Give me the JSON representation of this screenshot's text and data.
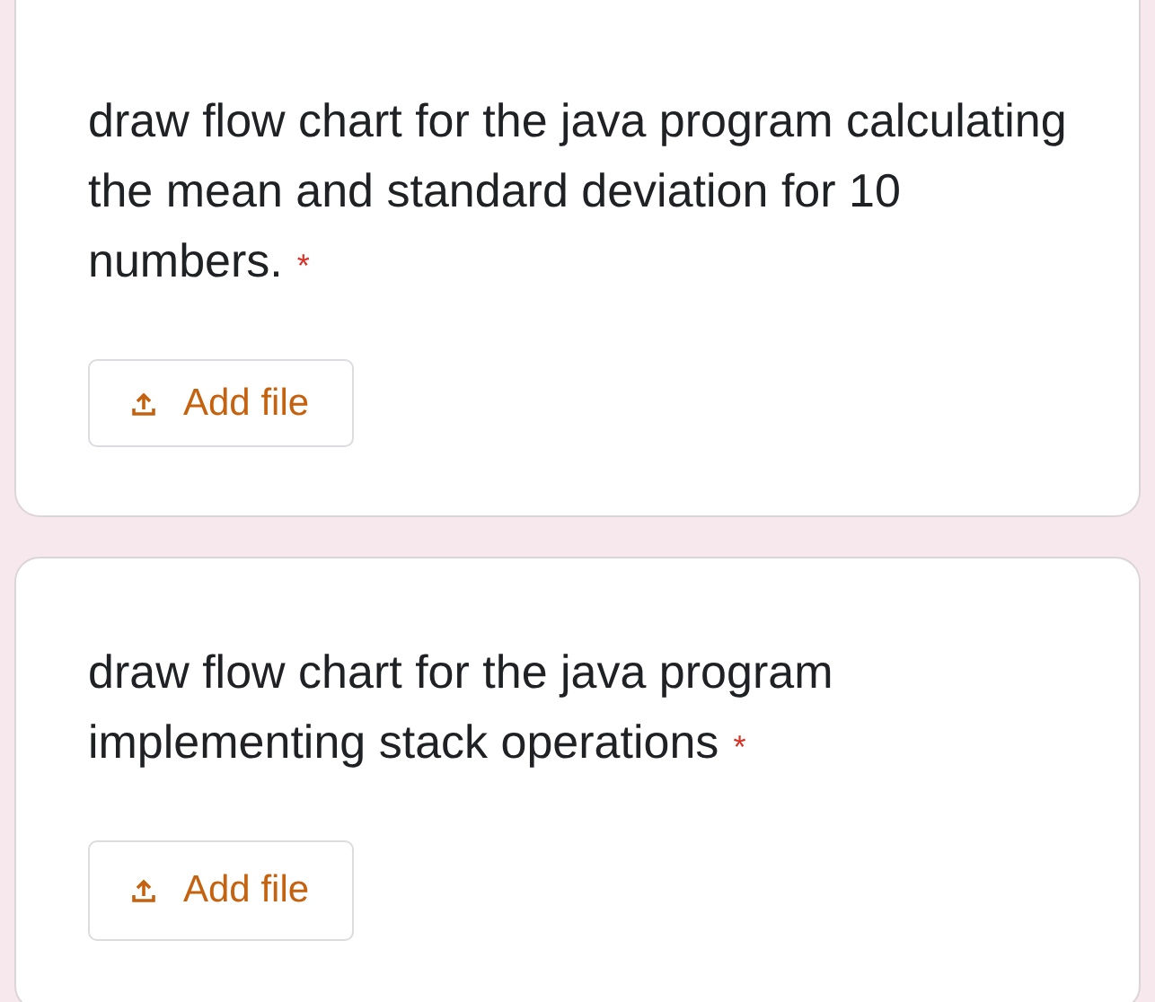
{
  "questions": [
    {
      "text": "draw flow chart for the java program calculating the mean and standard deviation for 10 numbers.",
      "required_mark": "*",
      "upload_button": "Add file"
    },
    {
      "text": "draw flow chart for the java program implementing stack operations",
      "required_mark": "*",
      "upload_button": "Add file"
    }
  ]
}
